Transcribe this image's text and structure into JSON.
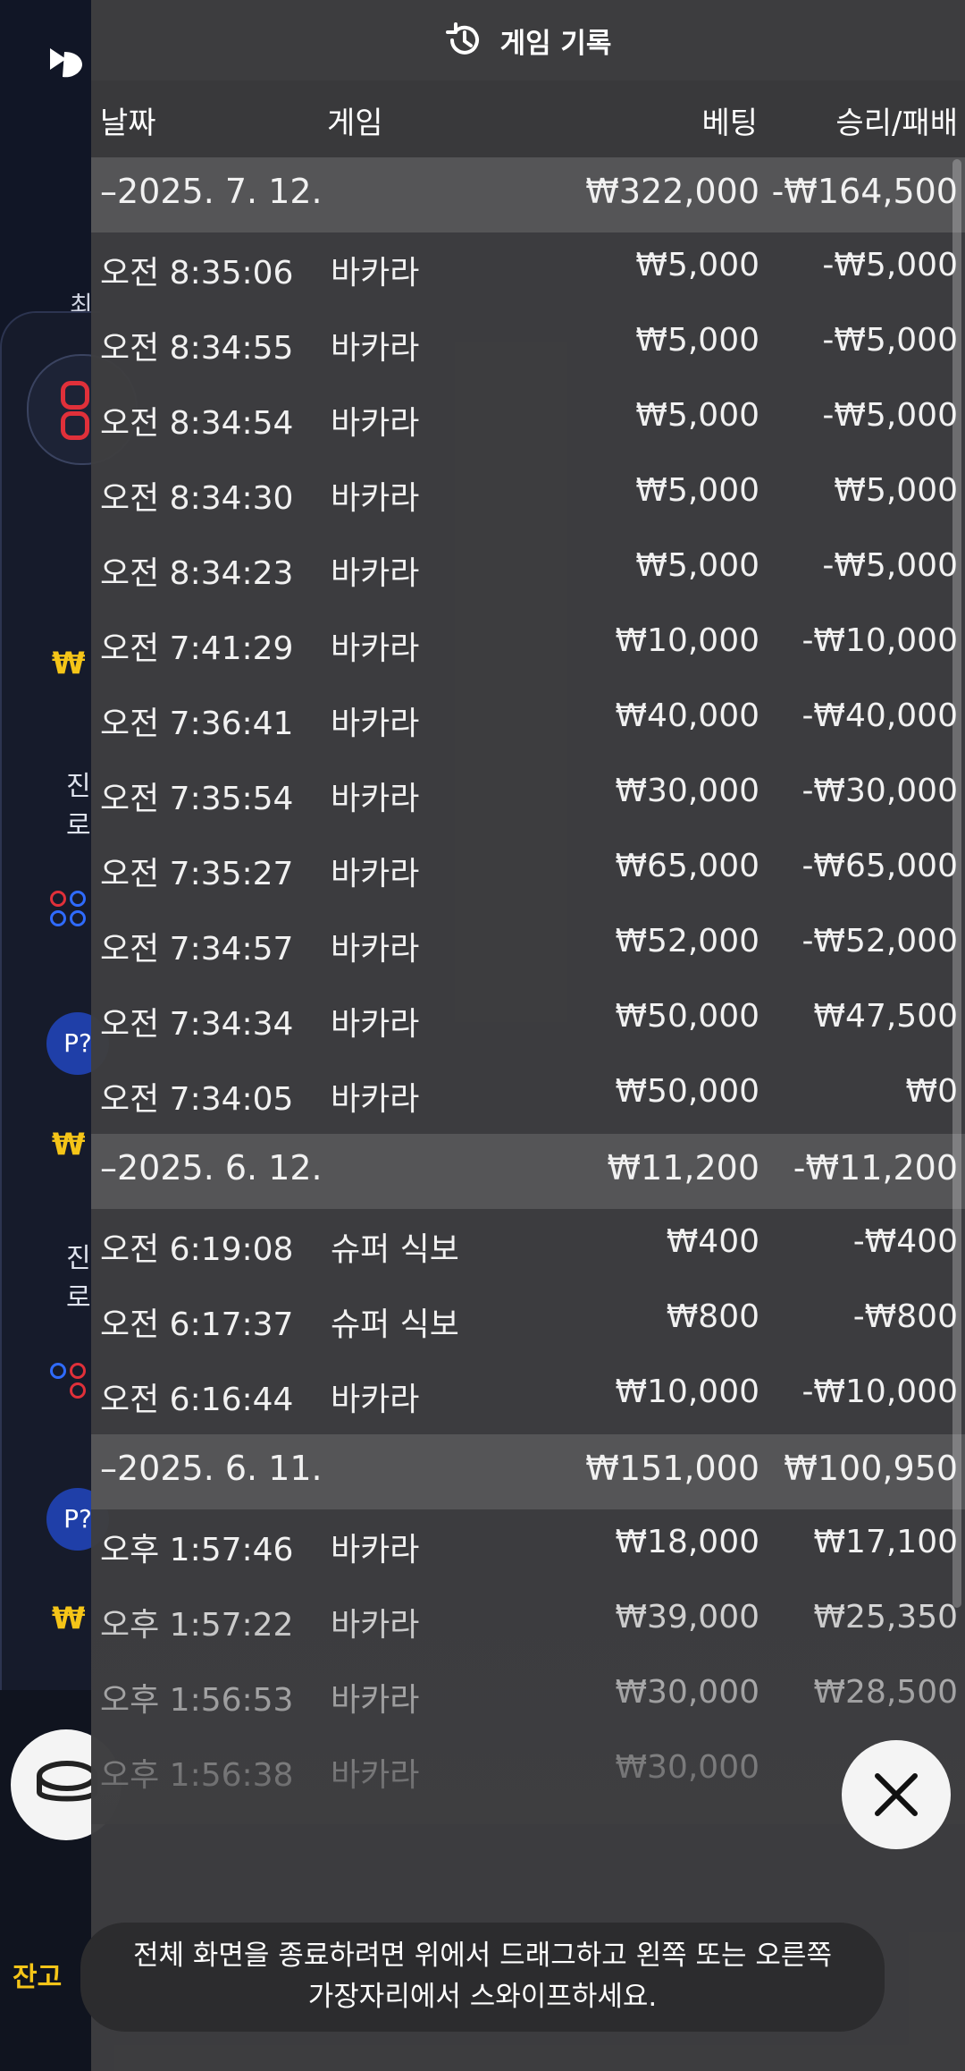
{
  "header": {
    "title": "게임 기록",
    "icon": "history-icon"
  },
  "columns": {
    "date": "날짜",
    "game": "게임",
    "bet": "베팅",
    "result": "승리/패배"
  },
  "groups": [
    {
      "date": "–2025. 7. 12.",
      "bet_total": "₩322,000",
      "result_total": "-₩164,500",
      "rows": [
        {
          "time": "오전 8:35:06",
          "game": "바카라",
          "bet": "₩5,000",
          "result": "-₩5,000"
        },
        {
          "time": "오전 8:34:55",
          "game": "바카라",
          "bet": "₩5,000",
          "result": "-₩5,000"
        },
        {
          "time": "오전 8:34:54",
          "game": "바카라",
          "bet": "₩5,000",
          "result": "-₩5,000"
        },
        {
          "time": "오전 8:34:30",
          "game": "바카라",
          "bet": "₩5,000",
          "result": "₩5,000"
        },
        {
          "time": "오전 8:34:23",
          "game": "바카라",
          "bet": "₩5,000",
          "result": "-₩5,000"
        },
        {
          "time": "오전 7:41:29",
          "game": "바카라",
          "bet": "₩10,000",
          "result": "-₩10,000"
        },
        {
          "time": "오전 7:36:41",
          "game": "바카라",
          "bet": "₩40,000",
          "result": "-₩40,000"
        },
        {
          "time": "오전 7:35:54",
          "game": "바카라",
          "bet": "₩30,000",
          "result": "-₩30,000"
        },
        {
          "time": "오전 7:35:27",
          "game": "바카라",
          "bet": "₩65,000",
          "result": "-₩65,000"
        },
        {
          "time": "오전 7:34:57",
          "game": "바카라",
          "bet": "₩52,000",
          "result": "-₩52,000"
        },
        {
          "time": "오전 7:34:34",
          "game": "바카라",
          "bet": "₩50,000",
          "result": "₩47,500"
        },
        {
          "time": "오전 7:34:05",
          "game": "바카라",
          "bet": "₩50,000",
          "result": "₩0"
        }
      ]
    },
    {
      "date": "–2025. 6. 12.",
      "bet_total": "₩11,200",
      "result_total": "-₩11,200",
      "rows": [
        {
          "time": "오전 6:19:08",
          "game": "슈퍼 식보",
          "bet": "₩400",
          "result": "-₩400"
        },
        {
          "time": "오전 6:17:37",
          "game": "슈퍼 식보",
          "bet": "₩800",
          "result": "-₩800"
        },
        {
          "time": "오전 6:16:44",
          "game": "바카라",
          "bet": "₩10,000",
          "result": "-₩10,000"
        }
      ]
    },
    {
      "date": "–2025. 6. 11.",
      "bet_total": "₩151,000",
      "result_total": "₩100,950",
      "rows": [
        {
          "time": "오후 1:57:46",
          "game": "바카라",
          "bet": "₩18,000",
          "result": "₩17,100"
        },
        {
          "time": "오후 1:57:22",
          "game": "바카라",
          "bet": "₩39,000",
          "result": "₩25,350"
        },
        {
          "time": "오후 1:56:53",
          "game": "바카라",
          "bet": "₩30,000",
          "result": "₩28,500"
        },
        {
          "time": "오후 1:56:38",
          "game": "바카라",
          "bet": "₩30,000",
          "result": ""
        }
      ]
    }
  ],
  "toast": {
    "line1": "전체 화면을 종료하려면 위에서 드래그하고 왼쪽 또는 오른쪽",
    "line2": "가장자리에서 스와이프하세요."
  },
  "background": {
    "nav_fragment": "최",
    "frag_1": "진",
    "frag_2": "로",
    "frag_3": "진",
    "frag_4": "로",
    "p_button": "P?",
    "balance_label": "잔고"
  },
  "colors": {
    "overlay": "#3e3e40",
    "date_row": "#555557",
    "accent_coin": "#f5c518"
  }
}
